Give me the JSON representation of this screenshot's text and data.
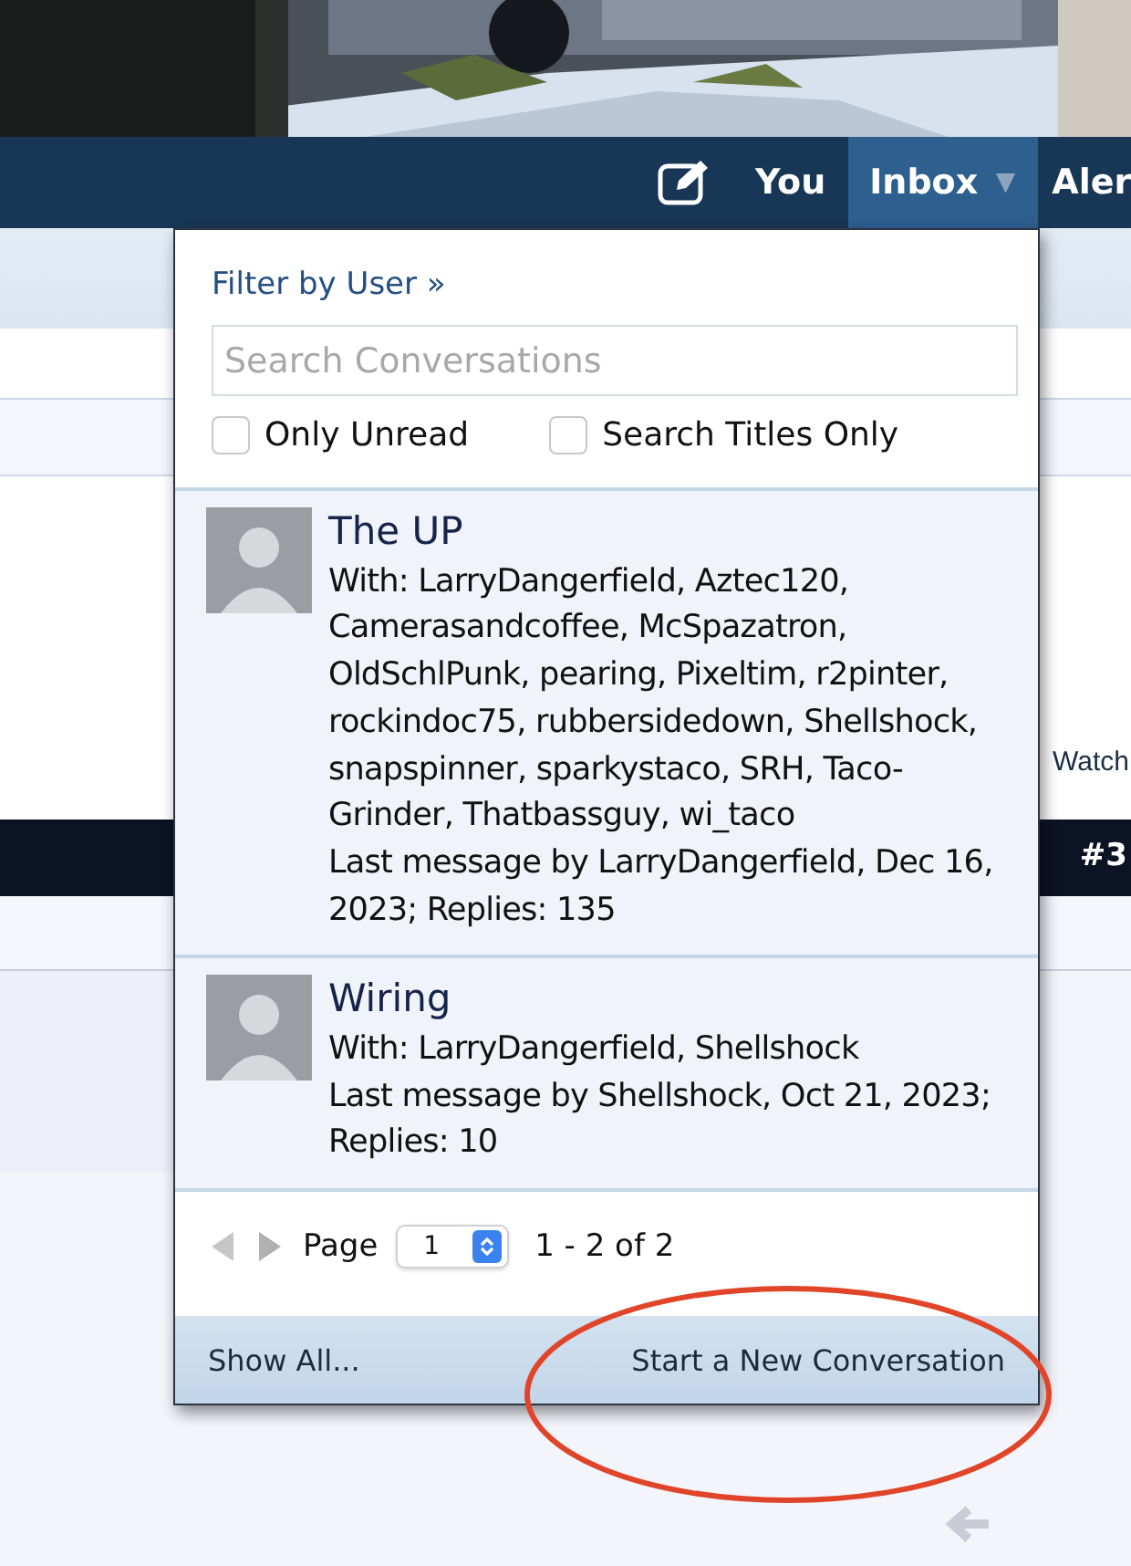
{
  "nav": {
    "items": [
      {
        "label": "You",
        "selected": false
      },
      {
        "label": "Inbox",
        "selected": true,
        "caret": "▼"
      },
      {
        "label": "Aler",
        "selected": false
      }
    ]
  },
  "background": {
    "watch_link": "Watch",
    "post_number": "#3"
  },
  "popup": {
    "filter_link": "Filter by User »",
    "search": {
      "placeholder": "Search Conversations"
    },
    "options": [
      {
        "label": "Only Unread",
        "checked": false
      },
      {
        "label": "Search Titles Only",
        "checked": false
      }
    ],
    "conversations": [
      {
        "title": "The UP",
        "participants": "With: LarryDangerfield, Aztec120, Camerasandcoffee, McSpazatron, OldSchlPunk, pearing, Pixeltim, r2pinter, rockindoc75, rubbersidedown, Shellshock, snapspinner, sparkystaco, SRH, Taco-Grinder, Thatbassguy, wi_taco",
        "last_message": "Last message by LarryDangerfield, Dec 16, 2023; Replies: 135"
      },
      {
        "title": "Wiring",
        "participants": "With: LarryDangerfield, Shellshock",
        "last_message": "Last message by Shellshock, Oct 21, 2023; Replies: 10"
      }
    ],
    "pager": {
      "page_label": "Page",
      "page_value": "1",
      "range": "1 - 2 of 2"
    },
    "footer": {
      "show_all": "Show All...",
      "start_new": "Start a New Conversation"
    }
  }
}
